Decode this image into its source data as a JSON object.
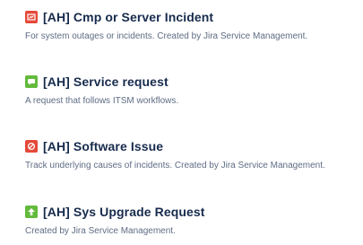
{
  "request_types": [
    {
      "title": "[AH] Cmp or Server Incident",
      "description": "For system outages or incidents. Created by Jira Service Management.",
      "icon": "incident-icon",
      "icon_color": "#e5493a"
    },
    {
      "title": "[AH] Service request",
      "description": "A request that follows ITSM workflows.",
      "icon": "chat-bubble-icon",
      "icon_color": "#63ba3c"
    },
    {
      "title": "[AH] Software Issue",
      "description": "Track underlying causes of incidents. Created by Jira Service Management.",
      "icon": "blocked-icon",
      "icon_color": "#e5493a"
    },
    {
      "title": "[AH] Sys Upgrade Request",
      "description": "Created by Jira Service Management.",
      "icon": "upgrade-arrow-icon",
      "icon_color": "#63ba3c"
    }
  ]
}
